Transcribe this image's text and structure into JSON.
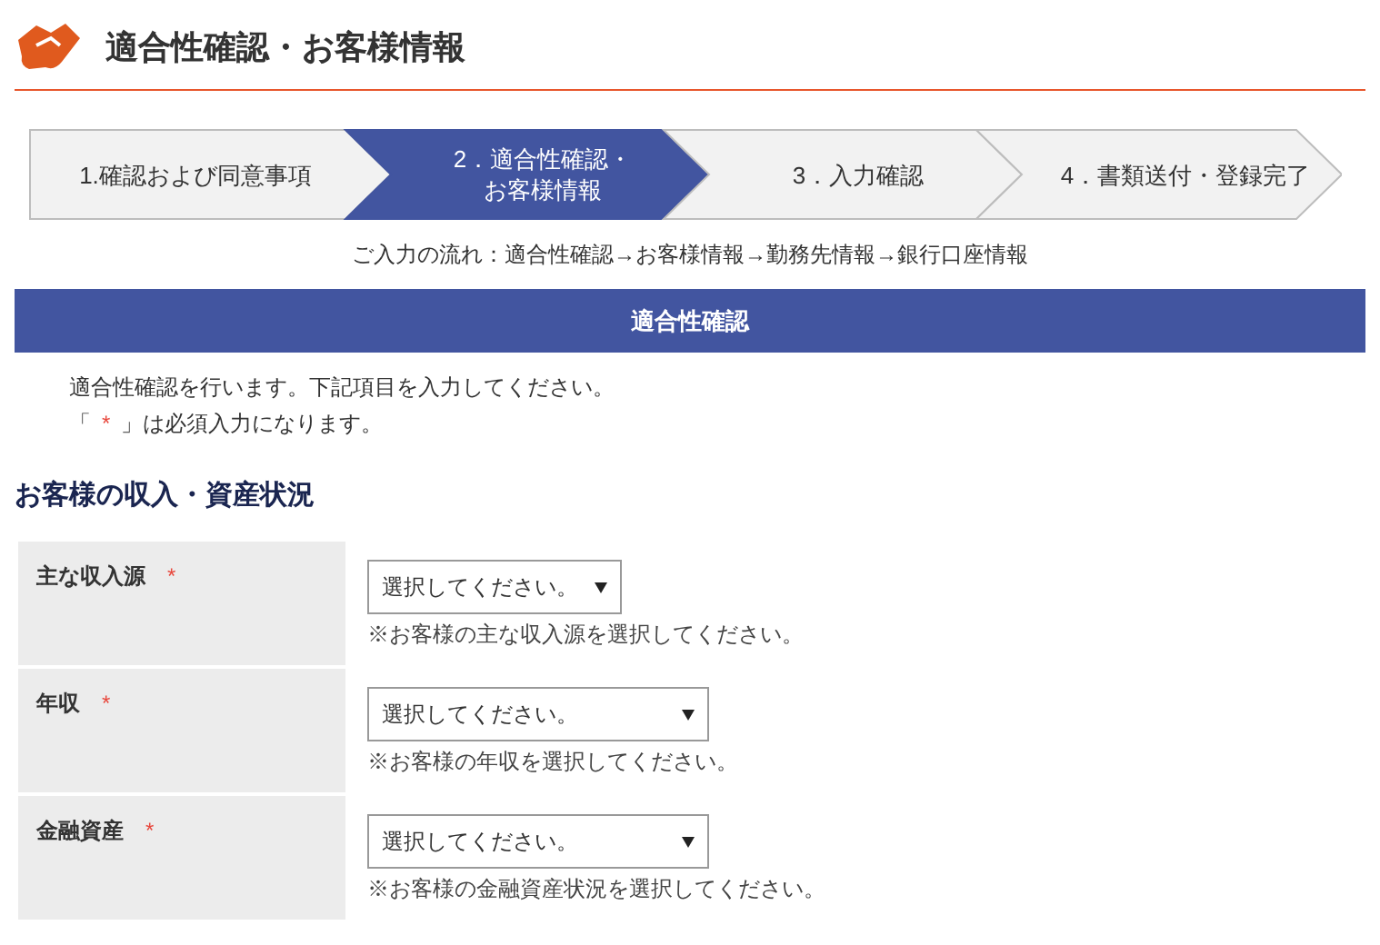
{
  "page_title": "適合性確認・お客様情報",
  "steps": [
    {
      "lines": [
        "1.確認および同意事項"
      ],
      "selected": false
    },
    {
      "lines": [
        "2．適合性確認・",
        "お客様情報"
      ],
      "selected": true
    },
    {
      "lines": [
        "3．入力確認"
      ],
      "selected": false
    },
    {
      "lines": [
        "4．書類送付・登録完了"
      ],
      "selected": false
    }
  ],
  "flow_note": "ご入力の流れ：適合性確認→お客様情報→勤務先情報→銀行口座情報",
  "section_bar": "適合性確認",
  "intro": "適合性確認を行います。下記項目を入力してください。",
  "required_note": {
    "before": "「",
    "mark": "*",
    "after": "」は必須入力になります。"
  },
  "heading": "お客様の収入・資産状況",
  "fields": [
    {
      "label": "主な収入源",
      "required": true,
      "required_mark": "*",
      "value": "選択してください。",
      "hint": "※お客様の主な収入源を選択してください。"
    },
    {
      "label": "年収",
      "required": true,
      "required_mark": "*",
      "value": "選択してください。",
      "hint": "※お客様の年収を選択してください。"
    },
    {
      "label": "金融資産",
      "required": true,
      "required_mark": "*",
      "value": "選択してください。",
      "hint": "※お客様の金融資産状況を選択してください。"
    }
  ]
}
